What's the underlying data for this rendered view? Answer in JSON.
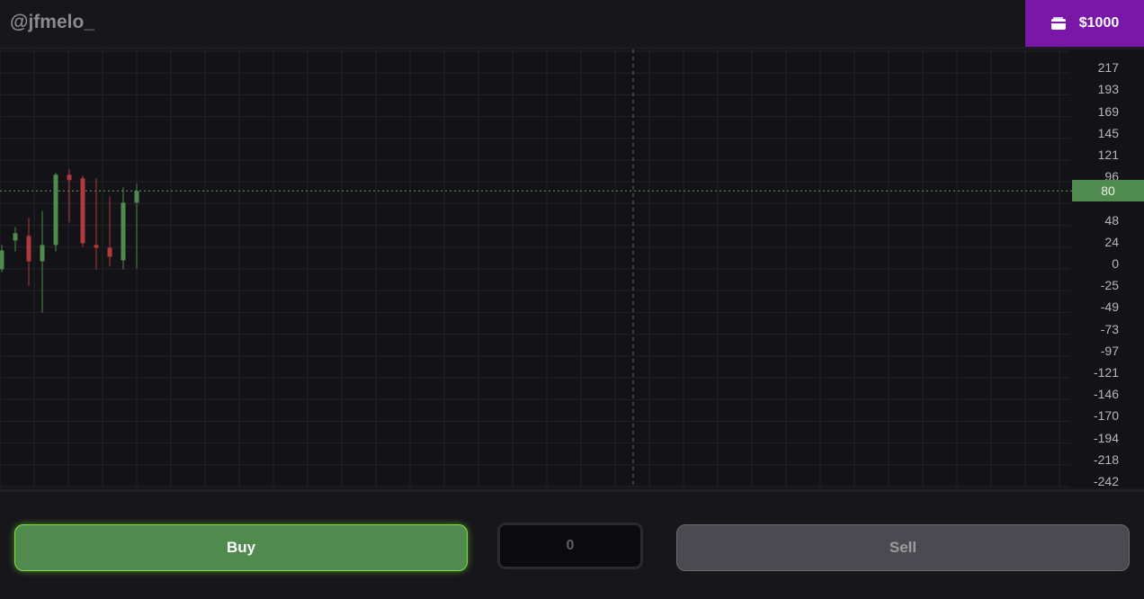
{
  "header": {
    "username": "@jfmelo_",
    "wallet_balance": "$1000",
    "wallet_icon": "wallet-icon"
  },
  "chart": {
    "y_ticks": [
      "217",
      "193",
      "169",
      "145",
      "121",
      "96",
      "48",
      "24",
      "0",
      "-25",
      "-49",
      "-73",
      "-97",
      "-121",
      "-146",
      "-170",
      "-194",
      "-218",
      "-242"
    ],
    "current_price": "80"
  },
  "chart_data": {
    "type": "candlestick",
    "current_price": 80,
    "ylim": [
      -242,
      217
    ],
    "candles": [
      {
        "open": -7,
        "close": 14,
        "high": 20,
        "low": -10
      },
      {
        "open": 25,
        "close": 33,
        "high": 40,
        "low": 13
      },
      {
        "open": 30,
        "close": 2,
        "high": 50,
        "low": -25
      },
      {
        "open": 2,
        "close": 20,
        "high": 58,
        "low": -55
      },
      {
        "open": 20,
        "close": 98,
        "high": 100,
        "low": 13
      },
      {
        "open": 98,
        "close": 92,
        "high": 104,
        "low": 45
      },
      {
        "open": 94,
        "close": 22,
        "high": 97,
        "low": 18
      },
      {
        "open": 20,
        "close": 17,
        "high": 94,
        "low": -7
      },
      {
        "open": 17,
        "close": 7,
        "high": 74,
        "low": -4
      },
      {
        "open": 3,
        "close": 67,
        "high": 84,
        "low": -7
      },
      {
        "open": 67,
        "close": 80,
        "high": 88,
        "low": -6
      }
    ]
  },
  "controls": {
    "buy_label": "Buy",
    "quantity": "0",
    "sell_label": "Sell"
  }
}
